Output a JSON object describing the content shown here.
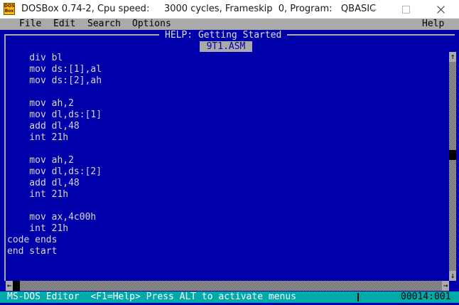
{
  "window": {
    "icon_text": "DOS\nBox",
    "title": "DOSBox 0.74-2, Cpu speed:     3000 cycles, Frameskip  0, Program:   QBASIC"
  },
  "menu": {
    "items": [
      "File",
      "Edit",
      "Search",
      "Options"
    ],
    "help": "Help"
  },
  "help_window": {
    "title": "HELP: Getting Started",
    "tab": "9T1.ASM"
  },
  "code_lines": [
    "    div bl",
    "    mov ds:[1],al",
    "    mov ds:[2],ah",
    "",
    "    mov ah,2",
    "    mov dl,ds:[1]",
    "    add dl,48",
    "    int 21h",
    "",
    "    mov ah,2",
    "    mov dl,ds:[2]",
    "    add dl,48",
    "    int 21h",
    "",
    "    mov ax,4c00h",
    "    int 21h",
    "code ends",
    "end start"
  ],
  "scrollbars": {
    "up": "↑",
    "down": "↓",
    "left": "←",
    "right": "→"
  },
  "status": {
    "text": "MS-DOS Editor  <F1=Help> Press ALT to activate menus",
    "position": "00014:001"
  },
  "colors": {
    "screen_bg": "#0000aa",
    "menu_bg": "#aaaaaa",
    "status_bg": "#00aaaa",
    "text": "#d8d8d8"
  }
}
